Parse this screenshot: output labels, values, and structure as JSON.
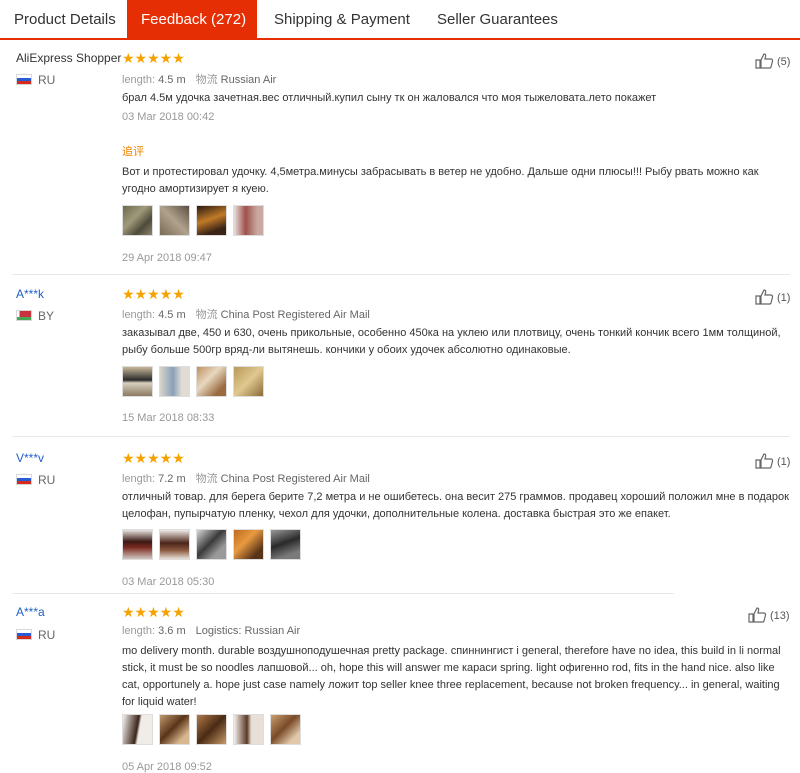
{
  "tabs": [
    {
      "label": "Product Details"
    },
    {
      "label": "Feedback (272)"
    },
    {
      "label": "Shipping & Payment"
    },
    {
      "label": "Seller Guarantees"
    }
  ],
  "reviews": [
    {
      "user": "AliExpress Shopper",
      "country": "RU",
      "stars": "★★★★★",
      "length_label": "length:",
      "length_value": "4.5 m",
      "shipping_label": "物流",
      "shipping_value": "Russian Air",
      "text": "брал 4.5м удочка зачетная.вес отличный.купил сыну тк он жаловался что моя тыжеловата.лето покажет",
      "date": "03 Mar 2018 00:42",
      "followup_label": "追评",
      "followup_text": "Вот и протестировал удочку. 4,5метра.минусы забрасывать в ветер не удобно. Дальше одни плюсы!!! Рыбу рвать можно как угодно амортизирует я куею.",
      "followup_date": "29 Apr 2018 09:47",
      "helpful": "(5)"
    },
    {
      "user": "A***k",
      "country": "BY",
      "stars": "★★★★★",
      "length_label": "length:",
      "length_value": "4.5 m",
      "shipping_label": "物流",
      "shipping_value": "China Post Registered Air Mail",
      "text": "заказывал две, 450 и 630, очень прикольные, особенно 450ка на уклею или плотвицу, очень тонкий кончик всего 1мм толщиной, рыбу больше 500гр вряд-ли вытянешь. кончики у обоих удочек абсолютно одинаковые.",
      "date": "15 Mar 2018 08:33",
      "helpful": "(1)"
    },
    {
      "user": "V***v",
      "country": "RU",
      "stars": "★★★★★",
      "length_label": "length:",
      "length_value": "7.2 m",
      "shipping_label": "物流",
      "shipping_value": "China Post Registered Air Mail",
      "text": "отличный товар. для берега берите 7,2 метра и не ошибетесь. она весит 275 граммов. продавец хороший положил мне в подарок целофан, пупырчатую пленку, чехол для удочки, дополнительные колена. доставка быстрая это же епакет.",
      "date": "03 Mar 2018 05:30",
      "helpful": "(1)"
    },
    {
      "user": "A***a",
      "country": "RU",
      "stars": "★★★★★",
      "length_label": "length:",
      "length_value": "3.6 m",
      "shipping_label": "Logistics:",
      "shipping_value": "Russian Air",
      "text": "mo delivery month. durable воздушноподушечная pretty package. спиннингист i general, therefore have no idea, this build in li normal stick, it must be so noodles лапшовой... oh, hope this will answer me караси spring. light офигенно rod, fits in the hand nice. also like cat, opportunely a. hope just case namely ложит top seller knee three replacement, because not broken frequency... in general, waiting for liquid water!",
      "date": "05 Apr 2018 09:52",
      "helpful": "(13)"
    }
  ]
}
